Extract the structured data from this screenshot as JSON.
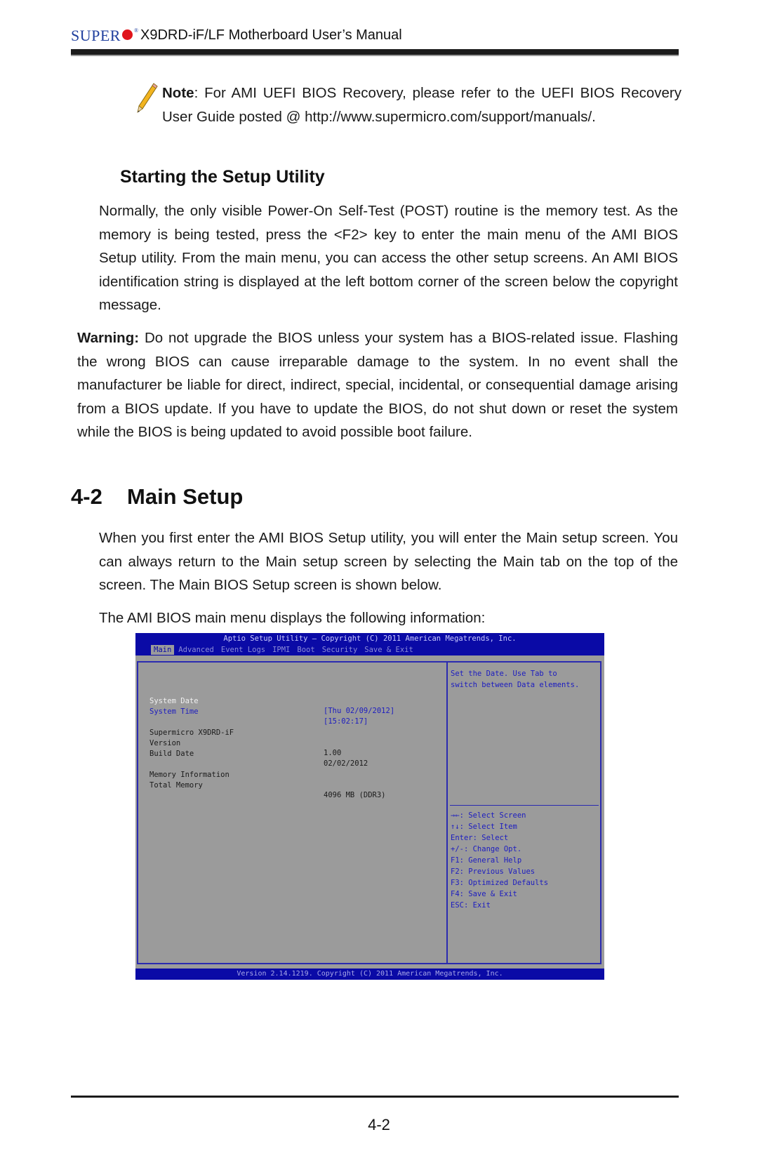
{
  "header": {
    "brand_name": "SUPER",
    "manual_title": "X9DRD-iF/LF Motherboard User’s Manual"
  },
  "note": {
    "label": "Note",
    "text": ": For AMI UEFI BIOS Recovery, please refer to the UEFI BIOS Recovery User Guide posted @ http://www.supermicro.com/support/manuals/."
  },
  "section_starting": {
    "title": "Starting the Setup Utility",
    "paragraph": "Normally, the only visible Power-On Self-Test (POST) routine is the memory test. As the memory is being tested, press the <F2> key to enter the main menu of the AMI BIOS Setup utility. From the main menu, you can access the other setup screens. An AMI BIOS identification string is displayed at the left bottom corner of the screen below the copyright message."
  },
  "warning": {
    "label": "Warning:",
    "text": " Do not upgrade the BIOS unless your system has a BIOS-related issue. Flashing the wrong BIOS can cause irreparable damage to the system. In no event shall the manufacturer be liable for direct, indirect, special, incidental, or consequential damage arising from a BIOS update. If you have to update the BIOS, do not shut down or reset the system while the BIOS is being updated to avoid possible boot failure."
  },
  "section_main": {
    "number": "4-2",
    "title": "Main Setup",
    "paragraph1": "When you first enter the AMI BIOS Setup utility, you will enter the Main setup screen. You can always return to the Main setup screen by selecting the Main tab on the top of the screen. The Main BIOS Setup screen is shown below.",
    "paragraph2": "The AMI BIOS main menu displays the following information:"
  },
  "bios": {
    "title": "Aptio Setup Utility – Copyright (C) 2011 American Megatrends, Inc.",
    "tabs": [
      "Main",
      "Advanced",
      "Event Logs",
      "IPMI",
      "Boot",
      "Security",
      "Save & Exit"
    ],
    "active_tab": "Main",
    "rows": [
      {
        "label": "System Date",
        "value": "[Thu 02/09/2012]"
      },
      {
        "label": "System Time",
        "value": "[15:02:17]"
      },
      {
        "label": "Supermicro X9DRD-iF",
        "value": ""
      },
      {
        "label": "Version",
        "value": "1.00"
      },
      {
        "label": "Build Date",
        "value": "02/02/2012"
      },
      {
        "label": "Memory Information",
        "value": ""
      },
      {
        "label": "Total Memory",
        "value": "4096 MB (DDR3)"
      }
    ],
    "help_text": [
      "Set the Date. Use Tab to",
      "switch between Data elements."
    ],
    "keys": [
      "→←: Select Screen",
      "↑↓: Select Item",
      "Enter: Select",
      "+/-: Change Opt.",
      "F1: General Help",
      "F2: Previous Values",
      "F3: Optimized Defaults",
      "F4: Save & Exit",
      "ESC: Exit"
    ],
    "footer": "Version 2.14.1219. Copyright (C) 2011 American Megatrends, Inc."
  },
  "footer": {
    "page_number": "4-2"
  }
}
